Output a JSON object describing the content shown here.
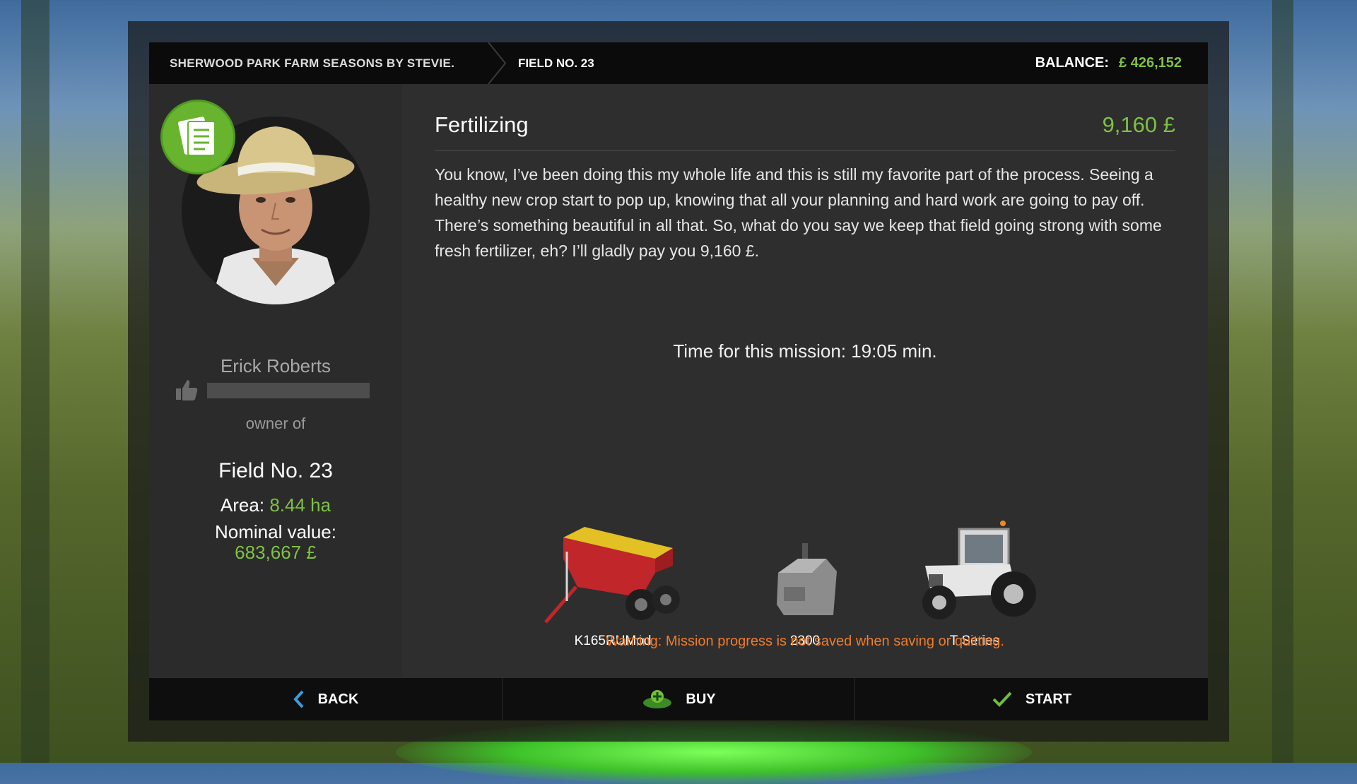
{
  "header": {
    "breadcrumb_farm": "SHERWOOD PARK FARM SEASONS BY STEVIE.",
    "breadcrumb_field": "FIELD NO. 23",
    "balance_label": "BALANCE:",
    "balance_value": "£ 426,152"
  },
  "npc": {
    "name": "Erick Roberts",
    "owner_of_label": "owner of",
    "field_name": "Field No. 23",
    "area_label": "Area:",
    "area_value": "8.44 ha",
    "nominal_label": "Nominal value:",
    "nominal_value": "683,667 £",
    "badge_icon": "contract-document-icon",
    "reputation_icon": "thumbs-up-icon"
  },
  "mission": {
    "title": "Fertilizing",
    "reward": "9,160 £",
    "description": "You know, I’ve been doing this my whole life and this is still my favorite part of the process. Seeing a healthy new crop start to pop up, knowing that all your planning and hard work are going to pay off. There’s something beautiful in all that. So, what do you say we keep that field going strong with some fresh fertilizer, eh? I’ll gladly pay you 9,160 £.",
    "time": "Time for this mission: 19:05 min.",
    "vehicles": [
      {
        "label": "K165RUMod",
        "icon": "fertilizer-spreader-icon"
      },
      {
        "label": "2300",
        "icon": "weight-icon"
      },
      {
        "label": "T Series",
        "icon": "tractor-icon"
      }
    ],
    "warning": "Warning: Mission progress is not saved when saving or quitting."
  },
  "footer": {
    "back_label": "BACK",
    "buy_label": "BUY",
    "start_label": "START"
  },
  "colors": {
    "accent_green": "#7dc243",
    "warning_orange": "#f07b2b",
    "back_icon_blue": "#3d9be0"
  }
}
